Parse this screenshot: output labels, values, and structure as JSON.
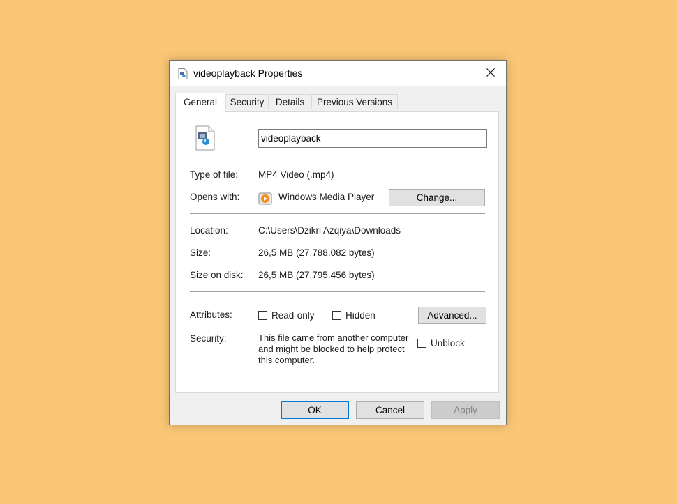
{
  "window": {
    "title": "videoplayback Properties",
    "title_icon": "video-file-icon",
    "close_icon": "close-icon"
  },
  "tabs": [
    {
      "label": "General",
      "active": true
    },
    {
      "label": "Security",
      "active": false
    },
    {
      "label": "Details",
      "active": false
    },
    {
      "label": "Previous Versions",
      "active": false
    }
  ],
  "general": {
    "file_icon": "video-file-icon",
    "file_name": "videoplayback",
    "type_label": "Type of file:",
    "type_value": "MP4 Video (.mp4)",
    "opens_label": "Opens with:",
    "opens_app_icon": "windows-media-player-icon",
    "opens_value": "Windows Media Player",
    "change_button": "Change...",
    "location_label": "Location:",
    "location_value": "C:\\Users\\Dzikri Azqiya\\Downloads",
    "size_label": "Size:",
    "size_value": "26,5 MB (27.788.082 bytes)",
    "size_disk_label": "Size on disk:",
    "size_disk_value": "26,5 MB (27.795.456 bytes)",
    "attributes_label": "Attributes:",
    "readonly_label": "Read-only",
    "readonly_checked": false,
    "hidden_label": "Hidden",
    "hidden_checked": false,
    "advanced_button": "Advanced...",
    "security_label": "Security:",
    "security_line1": "This file came from another computer",
    "security_line2": "and might be blocked to help protect",
    "security_line3": "this computer.",
    "unblock_label": "Unblock",
    "unblock_checked": false
  },
  "footer": {
    "ok_label": "OK",
    "cancel_label": "Cancel",
    "apply_label": "Apply"
  },
  "colors": {
    "background": "#fbc776",
    "accent": "#0078d7"
  }
}
